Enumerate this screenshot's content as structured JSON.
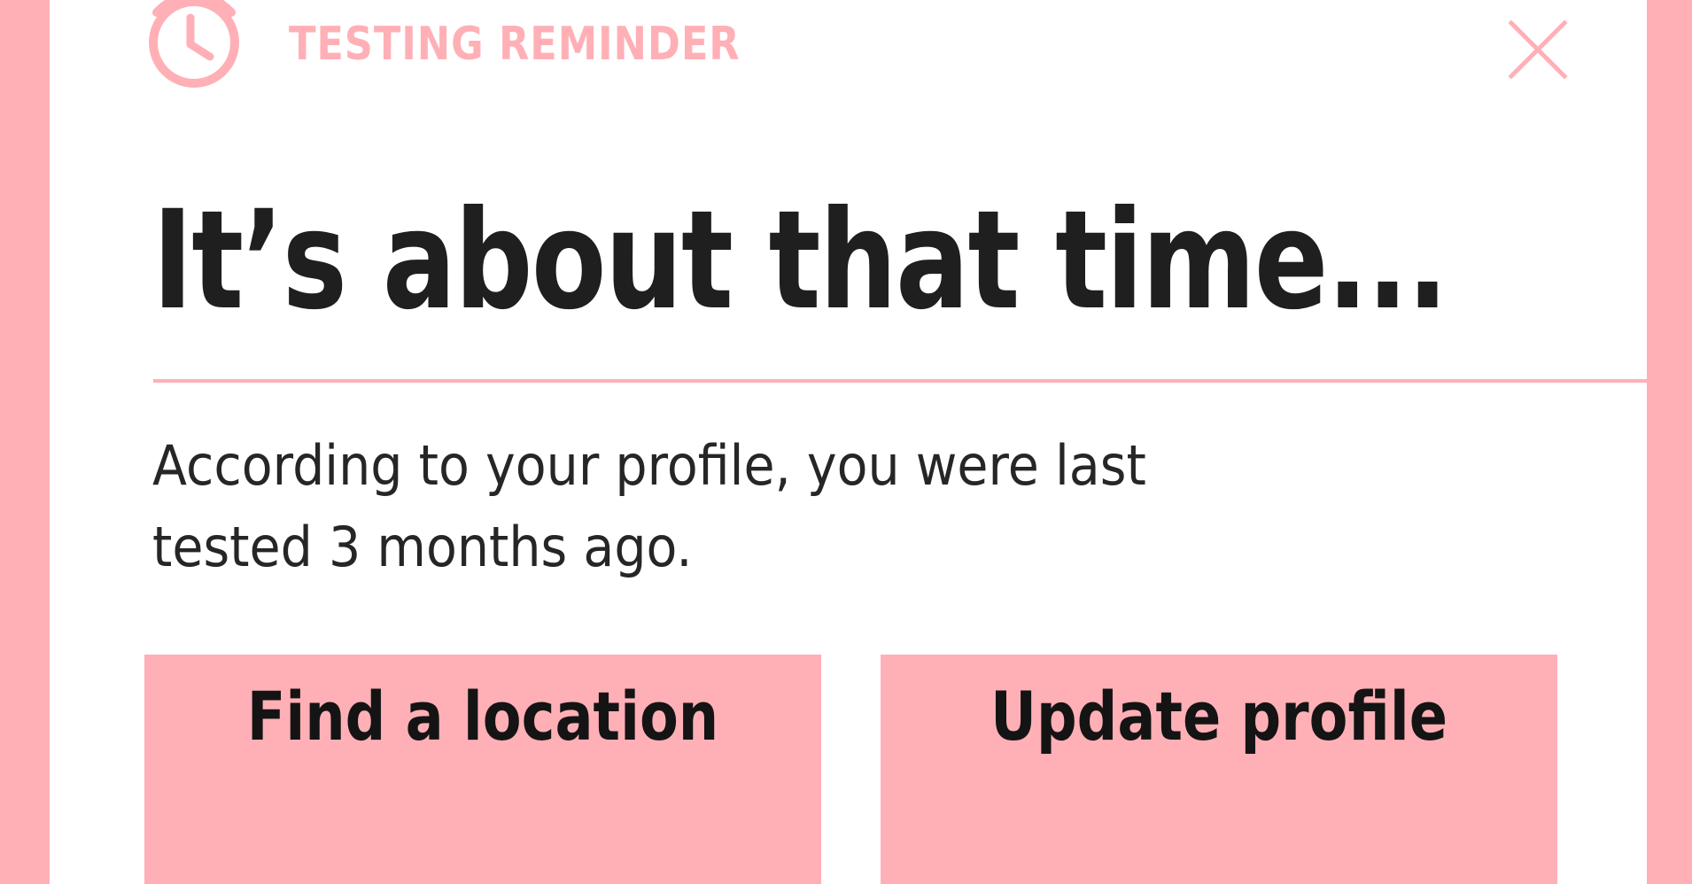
{
  "header": {
    "icon": "alarm-clock-icon",
    "label": "TESTING REMINDER",
    "close_icon": "close-icon"
  },
  "main": {
    "headline": "It’s about that time...",
    "message": "According to your profile, you were last tested 3 months ago."
  },
  "actions": {
    "find_location_label": "Find a location",
    "update_profile_label": "Update profile"
  },
  "colors": {
    "accent": "#ffb0b6",
    "text": "#1f1f1f",
    "background": "#ffffff"
  }
}
